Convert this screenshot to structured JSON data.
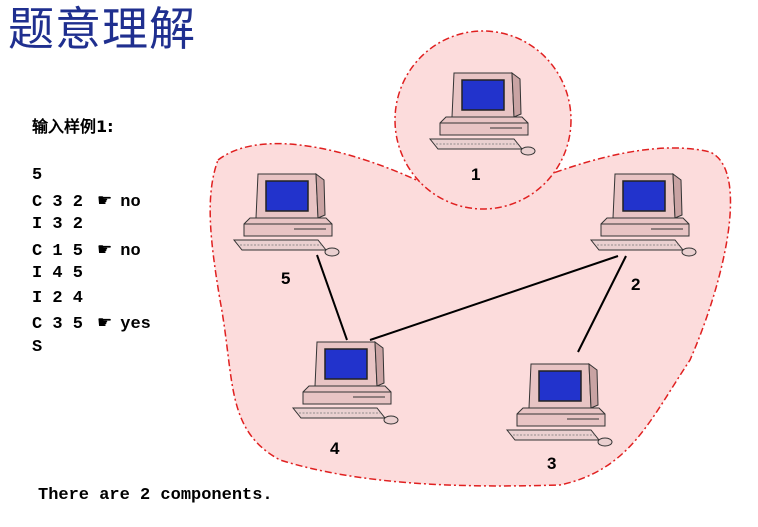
{
  "title": "题意理解",
  "input_label": "输入样例1:",
  "input_lines": [
    {
      "text": "5",
      "note": ""
    },
    {
      "text": "C 3 2",
      "note": "no"
    },
    {
      "text": "I 3 2",
      "note": ""
    },
    {
      "text": "C 1 5",
      "note": "no"
    },
    {
      "text": "I 4 5",
      "note": ""
    },
    {
      "text": "I 2 4",
      "note": ""
    },
    {
      "text": "C 3 5",
      "note": "yes"
    },
    {
      "text": "S",
      "note": ""
    }
  ],
  "pointer_glyph": "☛",
  "output_text": "There are 2 components.",
  "graph": {
    "nodes": [
      {
        "id": "1",
        "label": "1",
        "component": "A"
      },
      {
        "id": "2",
        "label": "2",
        "component": "B"
      },
      {
        "id": "3",
        "label": "3",
        "component": "B"
      },
      {
        "id": "4",
        "label": "4",
        "component": "B"
      },
      {
        "id": "5",
        "label": "5",
        "component": "B"
      }
    ],
    "edges": [
      [
        "5",
        "4"
      ],
      [
        "4",
        "2"
      ],
      [
        "2",
        "3"
      ]
    ]
  },
  "colors": {
    "title": "#1f2f8f",
    "region_fill": "#fcdcdc",
    "region_border": "#e02020",
    "screen": "#2233cc",
    "computer_body": "#e8c4c4"
  }
}
